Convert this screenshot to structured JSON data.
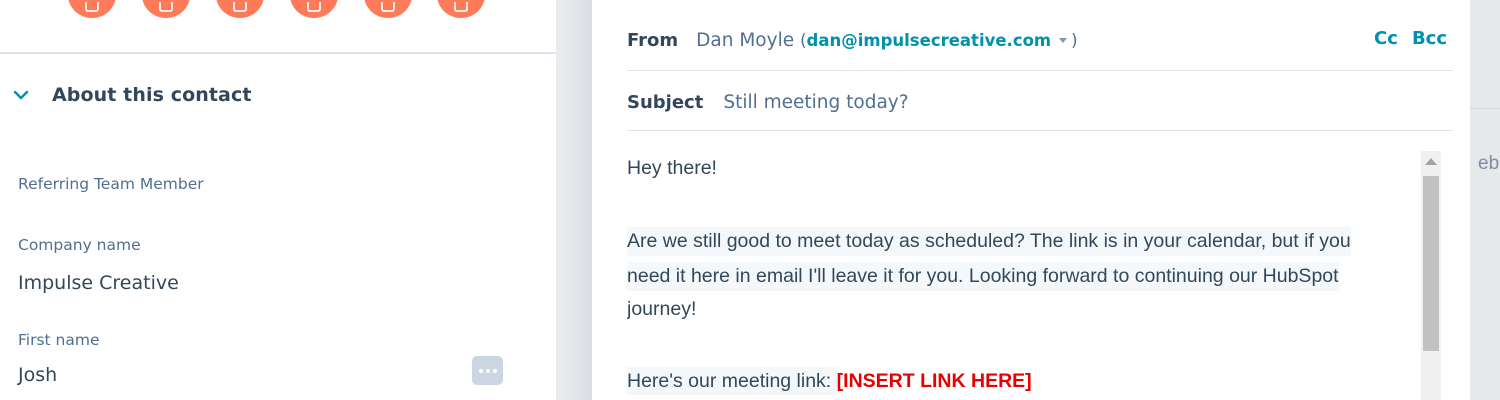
{
  "contact_panel": {
    "action_buttons": [
      {
        "icon": "note-icon"
      },
      {
        "icon": "email-icon"
      },
      {
        "icon": "call-icon"
      },
      {
        "icon": "log-icon"
      },
      {
        "icon": "task-icon"
      },
      {
        "icon": "more-icon"
      }
    ],
    "section_title": "About this contact",
    "properties": [
      {
        "label": "Referring Team Member",
        "value": ""
      },
      {
        "label": "Company name",
        "value": "Impulse Creative"
      },
      {
        "label": "First name",
        "value": "Josh"
      }
    ]
  },
  "email_compose": {
    "from_label": "From",
    "from_name": "Dan Moyle",
    "from_email": "dan@impulsecreative.com",
    "cc_label": "Cc",
    "bcc_label": "Bcc",
    "subject_label": "Subject",
    "subject_value": "Still meeting today?",
    "body": {
      "greeting": "Hey there!",
      "paragraph_line_1": "Are we still good to meet today as scheduled? The link is in your calendar, but if you",
      "paragraph_line_2": "need it here in email I'll leave it for you. Looking forward to continuing our HubSpot",
      "paragraph_line_3": "journey!",
      "link_prefix": "Here's our meeting link: ",
      "link_placeholder": "[INSERT LINK HERE]"
    }
  },
  "background": {
    "partial_text": "eb"
  },
  "colors": {
    "accent_orange": "#ff7a59",
    "link_teal": "#0091ae",
    "placeholder_red": "#e60000",
    "text_dark": "#33475b"
  }
}
